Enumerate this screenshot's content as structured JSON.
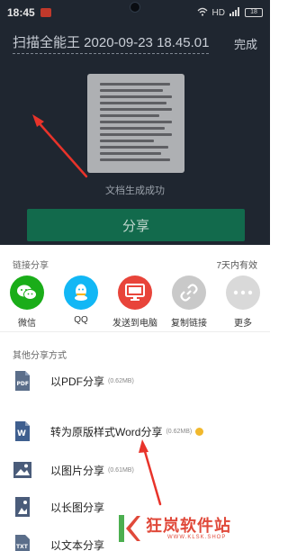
{
  "status_bar": {
    "time": "18:45",
    "signal_text": "HD",
    "battery": "18"
  },
  "header": {
    "title": "扫描全能王 2020-09-23 18.45.01",
    "done_label": "完成"
  },
  "preview": {
    "caption": "文档生成成功"
  },
  "share_button_label": "分享",
  "sheet": {
    "link_share_title": "链接分享",
    "validity": "7天内有效",
    "apps": [
      {
        "label": "微信",
        "icon": "wechat-icon",
        "color": "#1aad19"
      },
      {
        "label": "QQ",
        "icon": "qq-icon",
        "color": "#12b7f5"
      },
      {
        "label": "发送到电脑",
        "icon": "monitor-icon",
        "color": "#e8443a"
      },
      {
        "label": "复制链接",
        "icon": "link-icon",
        "color": "#c9c9c9"
      },
      {
        "label": "更多",
        "icon": "more-icon",
        "color": "#d9d9d9"
      }
    ],
    "other_title": "其他分享方式",
    "options": [
      {
        "label": "以PDF分享",
        "size": "(0.62MB)",
        "icon": "pdf-icon"
      },
      {
        "label": "转为原版样式Word分享",
        "size": "(0.62MB)",
        "icon": "word-icon",
        "premium": true
      },
      {
        "label": "以图片分享",
        "size": "(0.61MB)",
        "icon": "image-icon"
      },
      {
        "label": "以长图分享",
        "size": "",
        "icon": "long-image-icon"
      },
      {
        "label": "以文本分享",
        "size": "",
        "icon": "txt-icon"
      }
    ]
  },
  "watermark": {
    "brand": "狂岚软件站",
    "url": "WWW.KLSK.SHOP"
  },
  "colors": {
    "accent_green": "#126a4c",
    "annotation_red": "#e8332a"
  }
}
